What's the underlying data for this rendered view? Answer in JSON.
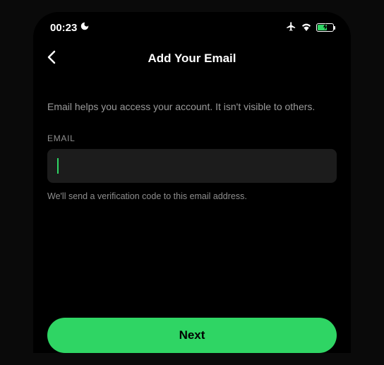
{
  "statusBar": {
    "time": "00:23"
  },
  "header": {
    "title": "Add Your Email"
  },
  "body": {
    "description": "Email helps you access your account. It isn't visible to others.",
    "fieldLabel": "EMAIL",
    "inputValue": "",
    "hint": "We'll send a verification code to this email address."
  },
  "footer": {
    "nextLabel": "Next"
  }
}
